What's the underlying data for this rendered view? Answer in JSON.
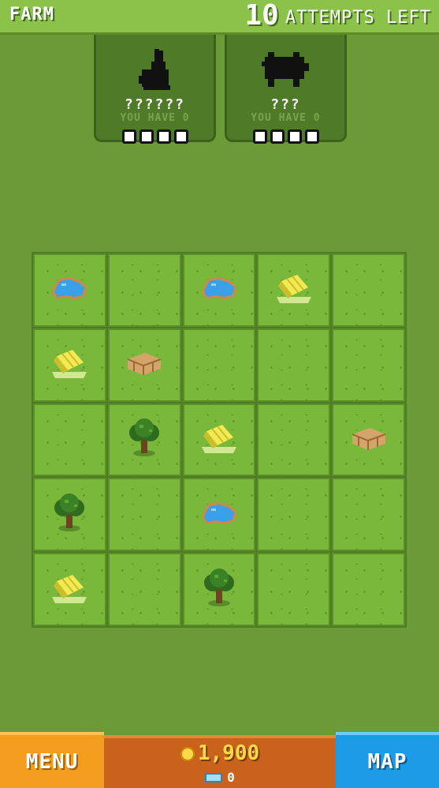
{
  "header": {
    "title": "FARM",
    "attempts_count": "10",
    "attempts_label": "ATTEMPTS LEFT"
  },
  "cards": [
    {
      "animal_icon": "rabbit-silhouette-icon",
      "name": "??????",
      "have_label": "YOU HAVE 0",
      "slots_total": 4
    },
    {
      "animal_icon": "pig-silhouette-icon",
      "name": "???",
      "have_label": "YOU HAVE 0",
      "slots_total": 4
    }
  ],
  "grid": {
    "rows": [
      [
        "pond",
        "empty",
        "pond",
        "hay",
        "empty"
      ],
      [
        "hay",
        "fence",
        "empty",
        "empty",
        "empty"
      ],
      [
        "empty",
        "tree",
        "hay",
        "empty",
        "fence"
      ],
      [
        "tree",
        "empty",
        "pond",
        "empty",
        "empty"
      ],
      [
        "hay",
        "empty",
        "tree",
        "empty",
        "empty"
      ]
    ]
  },
  "footer": {
    "menu_label": "MENU",
    "coins": "1,900",
    "gems": "0",
    "map_label": "MAP"
  },
  "colors": {
    "background": "#6d9a38",
    "topbar": "#8bc34a",
    "menu_button": "#f39c1e",
    "center_panel": "#c9621a",
    "map_button": "#1e9be6",
    "coin": "#ffd84a"
  }
}
